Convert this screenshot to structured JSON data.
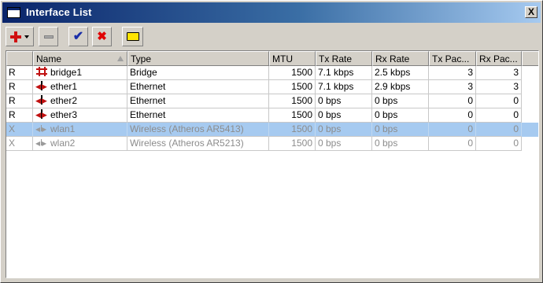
{
  "window": {
    "title": "Interface List",
    "close_label": "X"
  },
  "toolbar": {
    "buttons": [
      {
        "name": "add",
        "icon": "plus-icon",
        "has_dropdown": true
      },
      {
        "name": "remove",
        "icon": "minus-icon",
        "enabled": false
      },
      {
        "name": "enable",
        "icon": "check-icon"
      },
      {
        "name": "disable",
        "icon": "x-icon"
      },
      {
        "name": "comment",
        "icon": "comment-icon"
      }
    ]
  },
  "table": {
    "columns": [
      "",
      "Name",
      "Type",
      "MTU",
      "Tx Rate",
      "Rx Rate",
      "Tx Pac...",
      "Rx Pac..."
    ],
    "sort_column": "Name",
    "rows": [
      {
        "flag": "R",
        "icon": "bridge-icon",
        "name": "bridge1",
        "type": "Bridge",
        "mtu": "1500",
        "tx_rate": "7.1 kbps",
        "rx_rate": "2.5 kbps",
        "tx_pac": "3",
        "rx_pac": "3",
        "disabled": false,
        "selected": false
      },
      {
        "flag": "R",
        "icon": "ethernet-icon",
        "name": "ether1",
        "type": "Ethernet",
        "mtu": "1500",
        "tx_rate": "7.1 kbps",
        "rx_rate": "2.9 kbps",
        "tx_pac": "3",
        "rx_pac": "3",
        "disabled": false,
        "selected": false
      },
      {
        "flag": "R",
        "icon": "ethernet-icon",
        "name": "ether2",
        "type": "Ethernet",
        "mtu": "1500",
        "tx_rate": "0 bps",
        "rx_rate": "0 bps",
        "tx_pac": "0",
        "rx_pac": "0",
        "disabled": false,
        "selected": false
      },
      {
        "flag": "R",
        "icon": "ethernet-icon",
        "name": "ether3",
        "type": "Ethernet",
        "mtu": "1500",
        "tx_rate": "0 bps",
        "rx_rate": "0 bps",
        "tx_pac": "0",
        "rx_pac": "0",
        "disabled": false,
        "selected": false
      },
      {
        "flag": "X",
        "icon": "wireless-icon",
        "name": "wlan1",
        "type": "Wireless (Atheros AR5413)",
        "mtu": "1500",
        "tx_rate": "0 bps",
        "rx_rate": "0 bps",
        "tx_pac": "0",
        "rx_pac": "0",
        "disabled": true,
        "selected": true
      },
      {
        "flag": "X",
        "icon": "wireless-icon",
        "name": "wlan2",
        "type": "Wireless (Atheros AR5213)",
        "mtu": "1500",
        "tx_rate": "0 bps",
        "rx_rate": "0 bps",
        "tx_pac": "0",
        "rx_pac": "0",
        "disabled": true,
        "selected": false
      }
    ]
  },
  "colors": {
    "title_gradient_start": "#0a246a",
    "title_gradient_end": "#a6caf0",
    "selection": "#a6caf0",
    "disabled_text": "#8c8c8c",
    "icon_red": "#c01010"
  }
}
